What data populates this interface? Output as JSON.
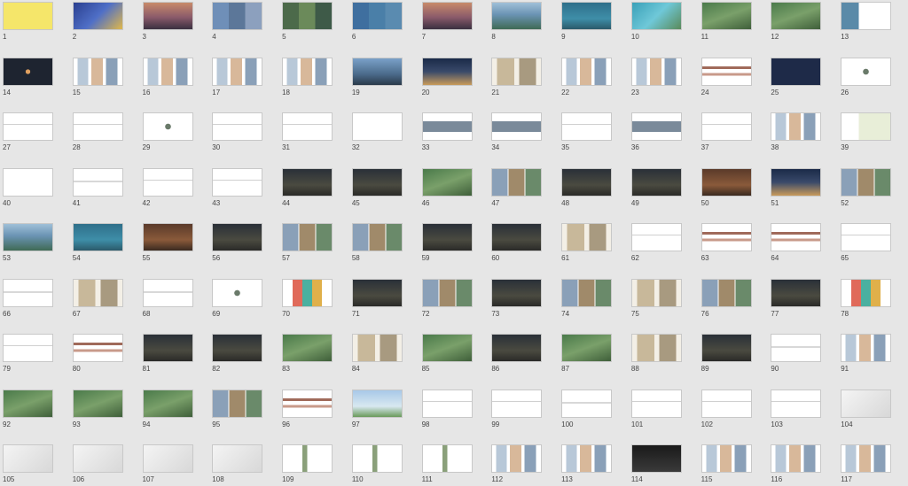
{
  "slides": [
    {
      "num": "1",
      "style": "yellow"
    },
    {
      "num": "2",
      "style": "blue-photo"
    },
    {
      "num": "3",
      "style": "dusk-city"
    },
    {
      "num": "4",
      "style": "sky-triptych"
    },
    {
      "num": "5",
      "style": "green-triptych"
    },
    {
      "num": "6",
      "style": "blue-triptych"
    },
    {
      "num": "7",
      "style": "dusk-city"
    },
    {
      "num": "8",
      "style": "lake"
    },
    {
      "num": "9",
      "style": "teal-lake"
    },
    {
      "num": "10",
      "style": "teal-coast"
    },
    {
      "num": "11",
      "style": "green-aerial"
    },
    {
      "num": "12",
      "style": "green-aerial"
    },
    {
      "num": "13",
      "style": "photo-text"
    },
    {
      "num": "14",
      "style": "dark-dots"
    },
    {
      "num": "15",
      "style": "white-photos"
    },
    {
      "num": "16",
      "style": "white-photos"
    },
    {
      "num": "17",
      "style": "white-photos"
    },
    {
      "num": "18",
      "style": "white-photos"
    },
    {
      "num": "19",
      "style": "city-wide"
    },
    {
      "num": "20",
      "style": "night-photo"
    },
    {
      "num": "21",
      "style": "beige-photos"
    },
    {
      "num": "22",
      "style": "white-photos"
    },
    {
      "num": "23",
      "style": "white-photos"
    },
    {
      "num": "24",
      "style": "org-chart"
    },
    {
      "num": "25",
      "style": "dark-text"
    },
    {
      "num": "26",
      "style": "white-icons"
    },
    {
      "num": "27",
      "style": "white-text"
    },
    {
      "num": "28",
      "style": "white-text"
    },
    {
      "num": "29",
      "style": "white-icons"
    },
    {
      "num": "30",
      "style": "white-text"
    },
    {
      "num": "31",
      "style": "white-text"
    },
    {
      "num": "32",
      "style": "white-blank"
    },
    {
      "num": "33",
      "style": "photo-strip"
    },
    {
      "num": "34",
      "style": "photo-strip"
    },
    {
      "num": "35",
      "style": "white-text"
    },
    {
      "num": "36",
      "style": "photo-strip"
    },
    {
      "num": "37",
      "style": "white-text"
    },
    {
      "num": "38",
      "style": "white-photos"
    },
    {
      "num": "39",
      "style": "map"
    },
    {
      "num": "40",
      "style": "calligraphy"
    },
    {
      "num": "41",
      "style": "white-chart"
    },
    {
      "num": "42",
      "style": "white-text"
    },
    {
      "num": "43",
      "style": "white-text"
    },
    {
      "num": "44",
      "style": "dark-landscape"
    },
    {
      "num": "45",
      "style": "dark-landscape"
    },
    {
      "num": "46",
      "style": "green-aerial"
    },
    {
      "num": "47",
      "style": "photo-grid"
    },
    {
      "num": "48",
      "style": "dark-landscape"
    },
    {
      "num": "49",
      "style": "dark-landscape"
    },
    {
      "num": "50",
      "style": "wood-room"
    },
    {
      "num": "51",
      "style": "night-photo"
    },
    {
      "num": "52",
      "style": "photo-grid"
    },
    {
      "num": "53",
      "style": "lake"
    },
    {
      "num": "54",
      "style": "teal-lake"
    },
    {
      "num": "55",
      "style": "wood-room"
    },
    {
      "num": "56",
      "style": "dark-landscape"
    },
    {
      "num": "57",
      "style": "photo-grid"
    },
    {
      "num": "58",
      "style": "photo-grid"
    },
    {
      "num": "59",
      "style": "dark-landscape"
    },
    {
      "num": "60",
      "style": "dark-landscape"
    },
    {
      "num": "61",
      "style": "beige-photos"
    },
    {
      "num": "62",
      "style": "white-text"
    },
    {
      "num": "63",
      "style": "org-chart"
    },
    {
      "num": "64",
      "style": "org-chart"
    },
    {
      "num": "65",
      "style": "white-text"
    },
    {
      "num": "66",
      "style": "white-chart"
    },
    {
      "num": "67",
      "style": "beige-photos"
    },
    {
      "num": "68",
      "style": "white-chart"
    },
    {
      "num": "69",
      "style": "white-icons"
    },
    {
      "num": "70",
      "style": "color-grid"
    },
    {
      "num": "71",
      "style": "dark-landscape"
    },
    {
      "num": "72",
      "style": "photo-grid"
    },
    {
      "num": "73",
      "style": "dark-landscape"
    },
    {
      "num": "74",
      "style": "photo-grid"
    },
    {
      "num": "75",
      "style": "beige-photos"
    },
    {
      "num": "76",
      "style": "photo-grid"
    },
    {
      "num": "77",
      "style": "dark-landscape"
    },
    {
      "num": "78",
      "style": "color-grid"
    },
    {
      "num": "79",
      "style": "white-text"
    },
    {
      "num": "80",
      "style": "org-chart"
    },
    {
      "num": "81",
      "style": "dark-landscape"
    },
    {
      "num": "82",
      "style": "dark-landscape"
    },
    {
      "num": "83",
      "style": "green-aerial"
    },
    {
      "num": "84",
      "style": "beige-photos"
    },
    {
      "num": "85",
      "style": "green-aerial"
    },
    {
      "num": "86",
      "style": "dark-landscape"
    },
    {
      "num": "87",
      "style": "green-aerial"
    },
    {
      "num": "88",
      "style": "beige-photos"
    },
    {
      "num": "89",
      "style": "dark-landscape"
    },
    {
      "num": "90",
      "style": "white-chart"
    },
    {
      "num": "91",
      "style": "white-photos"
    },
    {
      "num": "92",
      "style": "green-aerial"
    },
    {
      "num": "93",
      "style": "green-aerial"
    },
    {
      "num": "94",
      "style": "green-aerial"
    },
    {
      "num": "95",
      "style": "photo-grid"
    },
    {
      "num": "96",
      "style": "org-chart"
    },
    {
      "num": "97",
      "style": "building"
    },
    {
      "num": "98",
      "style": "white-text"
    },
    {
      "num": "99",
      "style": "white-text"
    },
    {
      "num": "100",
      "style": "white-chart"
    },
    {
      "num": "101",
      "style": "white-text"
    },
    {
      "num": "102",
      "style": "white-text"
    },
    {
      "num": "103",
      "style": "white-text"
    },
    {
      "num": "104",
      "style": "grey-object"
    },
    {
      "num": "105",
      "style": "grey-object"
    },
    {
      "num": "106",
      "style": "grey-object"
    },
    {
      "num": "107",
      "style": "grey-object"
    },
    {
      "num": "108",
      "style": "grey-object"
    },
    {
      "num": "109",
      "style": "white-tower"
    },
    {
      "num": "110",
      "style": "white-tower"
    },
    {
      "num": "111",
      "style": "white-tower"
    },
    {
      "num": "112",
      "style": "white-photos"
    },
    {
      "num": "113",
      "style": "white-photos"
    },
    {
      "num": "114",
      "style": "dark-photo"
    },
    {
      "num": "115",
      "style": "white-photos"
    },
    {
      "num": "116",
      "style": "white-photos"
    },
    {
      "num": "117",
      "style": "white-photos"
    }
  ],
  "colors": {
    "background": "#e6e6e6",
    "number": "#444444"
  }
}
